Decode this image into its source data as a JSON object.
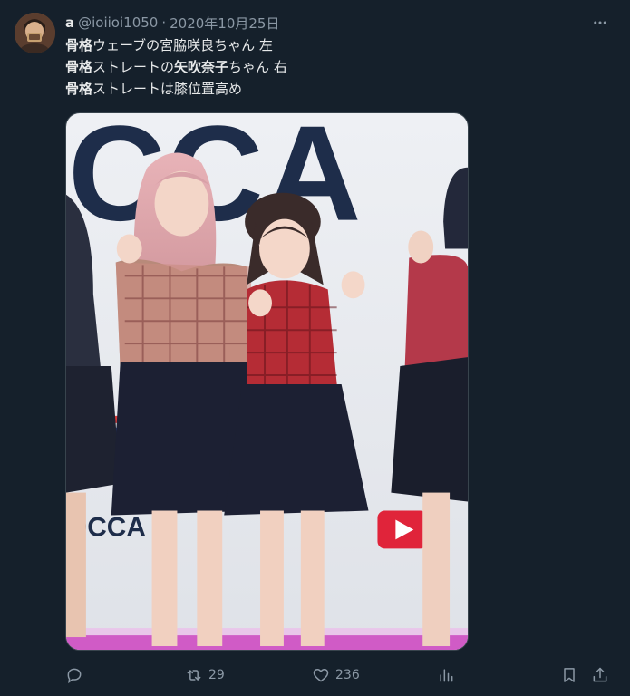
{
  "author": {
    "display_name": "a",
    "handle": "@ioiioi1050",
    "separator": "·",
    "date": "2020年10月25日"
  },
  "tweet": {
    "lines": [
      {
        "bold": "骨格",
        "rest": "ウェーブの宮脇咲良ちゃん 左"
      },
      {
        "bold": "骨格",
        "rest": "ストレートの",
        "bold2": "矢吹奈子",
        "rest2": "ちゃん  右"
      },
      {
        "bold": "骨格",
        "rest": "ストレートは膝位置高め"
      }
    ]
  },
  "media": {
    "backdrop_text": "CCA",
    "backdrop_text_small": "OCCA"
  },
  "actions": {
    "reply_count": "",
    "retweet_count": "29",
    "like_count": "236"
  },
  "icons": {
    "more": "more-dots-icon",
    "reply": "reply-icon",
    "retweet": "retweet-icon",
    "like": "heart-icon",
    "views": "views-chart-icon",
    "bookmark": "bookmark-icon",
    "share": "share-icon"
  },
  "colors": {
    "background": "#15202b",
    "text_primary": "#e7e9ea",
    "text_secondary": "#8b98a5",
    "border": "#38444d"
  }
}
